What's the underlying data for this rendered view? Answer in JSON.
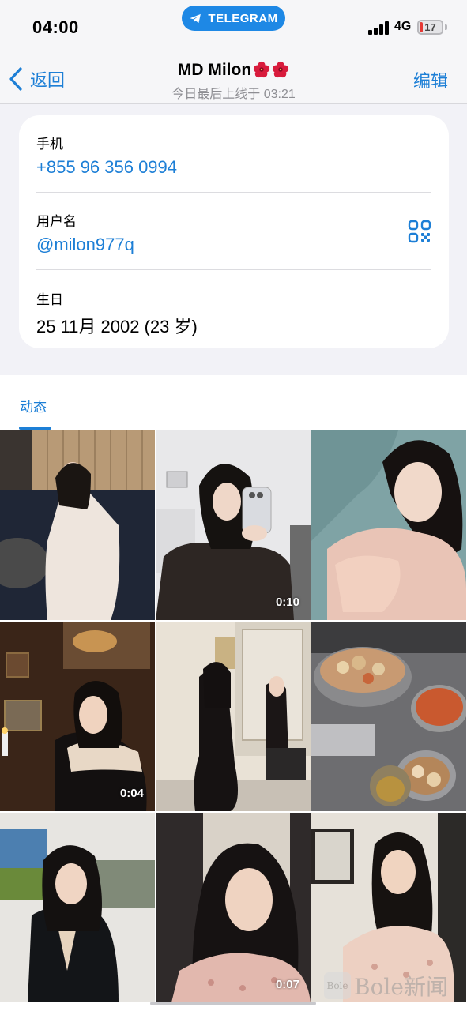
{
  "status_bar": {
    "time": "04:00",
    "app_pill": "TELEGRAM",
    "network": "4G",
    "battery": "17",
    "battery_color": "#e53935"
  },
  "header": {
    "back_label": "返回",
    "title": "MD Milon",
    "title_emoji": [
      "hibiscus-emoji",
      "hibiscus-emoji"
    ],
    "subtitle": "今日最后上线于 03:21",
    "edit_label": "编辑"
  },
  "info": {
    "phone_label": "手机",
    "phone_value": "+855 96 356 0994",
    "username_label": "用户名",
    "username_value": "@milon977q",
    "birthday_label": "生日",
    "birthday_value": "25 11月 2002 (23 岁)"
  },
  "tabs": [
    {
      "label": "动态",
      "active": true
    }
  ],
  "media": [
    {
      "name": "photo-1",
      "duration": ""
    },
    {
      "name": "video-2",
      "duration": "0:10"
    },
    {
      "name": "photo-3",
      "duration": ""
    },
    {
      "name": "video-4",
      "duration": "0:04"
    },
    {
      "name": "photo-5",
      "duration": ""
    },
    {
      "name": "photo-6",
      "duration": ""
    },
    {
      "name": "photo-7",
      "duration": ""
    },
    {
      "name": "video-8",
      "duration": "0:07"
    },
    {
      "name": "photo-9",
      "duration": ""
    }
  ],
  "watermark": {
    "box": "Bole",
    "text": "Bole新闻"
  },
  "colors": {
    "accent": "#1d7fd6",
    "telegram_blue": "#1e88e5"
  }
}
